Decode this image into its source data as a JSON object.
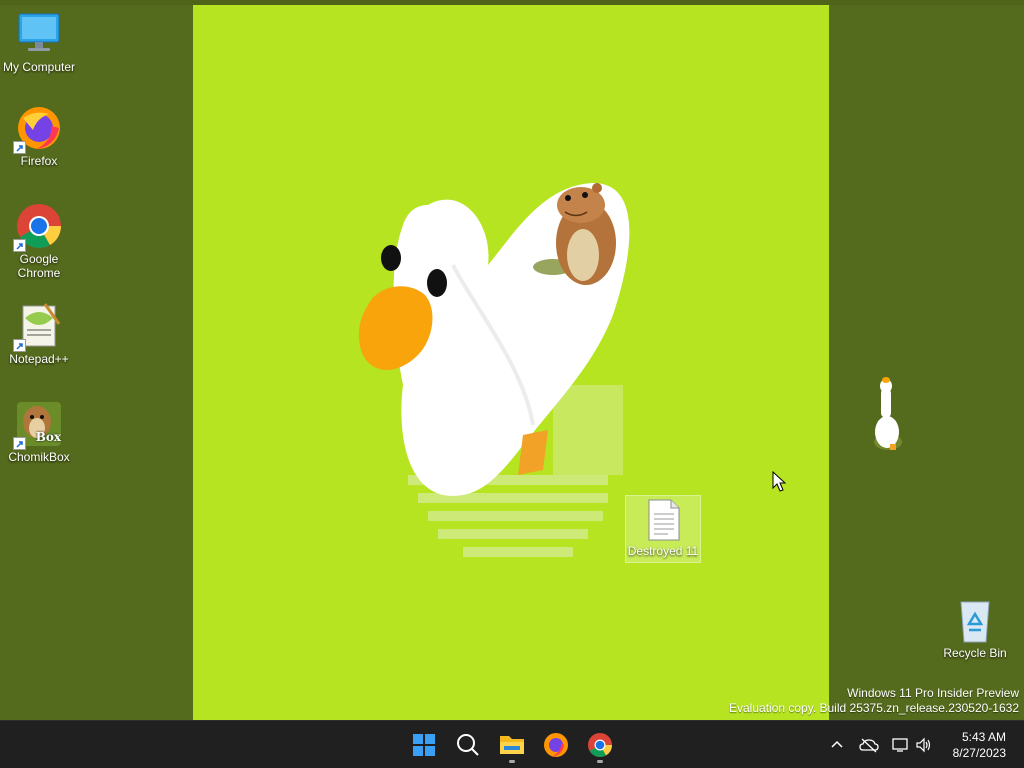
{
  "desktop": {
    "icons": [
      {
        "label": "My Computer",
        "icon": "monitor-icon"
      },
      {
        "label": "Firefox",
        "icon": "firefox-icon"
      },
      {
        "label": "Google\nChrome",
        "icon": "chrome-icon"
      },
      {
        "label": "Notepad++",
        "icon": "notepad-plus-plus-icon"
      },
      {
        "label": "ChomikBox",
        "icon": "chomikbox-icon",
        "badge": "Box"
      },
      {
        "label": "Destroyed 11",
        "icon": "document-icon"
      },
      {
        "label": "Recycle Bin",
        "icon": "recycle-bin-icon"
      }
    ]
  },
  "watermark": {
    "line1": "Windows 11 Pro Insider Preview",
    "line2": "Evaluation copy. Build 25375.zn_release.230520-1632"
  },
  "taskbar": {
    "apps": [
      "start-icon",
      "search-icon",
      "file-explorer-icon",
      "firefox-icon",
      "chrome-icon"
    ],
    "clock": {
      "time": "5:43 AM",
      "date": "8/27/2023"
    }
  },
  "colors": {
    "wallpaper": "#b6e421",
    "desktop_bg": "#546a1c",
    "taskbar": "#202020",
    "goose_beak": "#f9a40b"
  }
}
